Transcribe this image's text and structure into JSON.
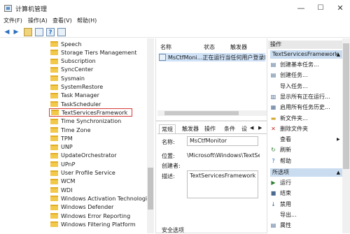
{
  "window": {
    "title": "计算机管理",
    "min": "—",
    "max": "☐",
    "close": "✕"
  },
  "menu": [
    "文件(F)",
    "操作(A)",
    "查看(V)",
    "帮助(H)"
  ],
  "tree_items": [
    "Speech",
    "Storage Tiers Management",
    "Subscription",
    "SyncCenter",
    "Sysmain",
    "SystemRestore",
    "Task Manager",
    "TaskScheduler",
    "TextServicesFramework",
    "Time Synchronization",
    "Time Zone",
    "TPM",
    "UNP",
    "UpdateOrchestrator",
    "UPnP",
    "User Profile Service",
    "WCM",
    "WDI",
    "Windows Activation Technologies",
    "Windows Defender",
    "Windows Error Reporting",
    "Windows Filtering Platform"
  ],
  "tree_selected": "TextServicesFramework",
  "list": {
    "headers": [
      "名称",
      "状态",
      "触发器"
    ],
    "row": {
      "name": "MsCtfMoni...",
      "status": "正在运行",
      "trigger": "当任何用户登录时"
    }
  },
  "detail": {
    "tabs": [
      "常规",
      "触发器",
      "操作",
      "条件",
      "设置"
    ],
    "name_label": "名称:",
    "name_value": "MsCtfMonitor",
    "location_label": "位置:",
    "location_value": "\\Microsoft\\Windows\\TextServicesFramework",
    "author_label": "创建者:",
    "desc_label": "描述:",
    "desc_value": "TextServicesFramework m",
    "security_label": "安全选项"
  },
  "actions": {
    "header": "操作",
    "section1": "TextServicesFramework",
    "items1": [
      {
        "icon": "create-basic-task-icon",
        "label": "创建基本任务..."
      },
      {
        "icon": "create-task-icon",
        "label": "创建任务..."
      },
      {
        "icon": "import-icon",
        "label": "导入任务..."
      },
      {
        "icon": "running-tasks-icon",
        "label": "显示所有正在运行..."
      },
      {
        "icon": "history-icon",
        "label": "启用所有任务历史..."
      },
      {
        "icon": "new-folder-icon",
        "label": "新文件夹..."
      },
      {
        "icon": "delete-folder-icon",
        "label": "删除文件夹"
      },
      {
        "icon": "view-icon",
        "label": "查看"
      },
      {
        "icon": "refresh-icon",
        "label": "刷新"
      },
      {
        "icon": "help-icon",
        "label": "帮助"
      }
    ],
    "section2": "所选项",
    "items2": [
      {
        "icon": "run-icon",
        "label": "运行"
      },
      {
        "icon": "end-icon",
        "label": "结束"
      },
      {
        "icon": "disable-icon",
        "label": "禁用"
      },
      {
        "icon": "export-icon",
        "label": "导出..."
      },
      {
        "icon": "properties-icon",
        "label": "属性"
      }
    ]
  },
  "colors": {
    "selection_outline": "#d63a3a",
    "selected_row": "#cfe2f7",
    "action_section": "#c9dcf0"
  }
}
